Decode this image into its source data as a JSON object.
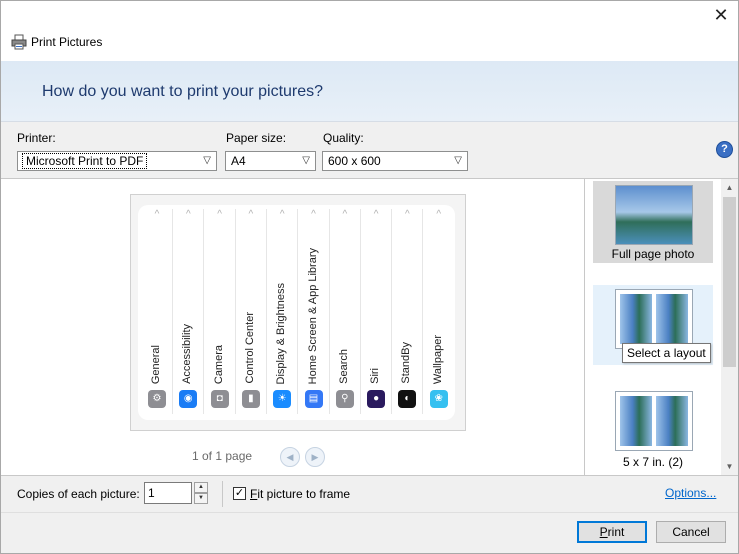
{
  "window": {
    "title": "Print Pictures",
    "close": "✕"
  },
  "header": {
    "question": "How do you want to print your pictures?"
  },
  "printer": {
    "label": "Printer:",
    "value": "Microsoft Print to PDF"
  },
  "paper_size": {
    "label": "Paper size:",
    "value": "A4"
  },
  "quality": {
    "label": "Quality:",
    "value": "600 x 600"
  },
  "help": {
    "glyph": "?"
  },
  "preview": {
    "settings": [
      {
        "label": "General",
        "color": "#8e8e93",
        "glyph": "⚙"
      },
      {
        "label": "Accessibility",
        "color": "#1a7cf5",
        "glyph": "◉"
      },
      {
        "label": "Camera",
        "color": "#8e8e93",
        "glyph": "◘"
      },
      {
        "label": "Control Center",
        "color": "#8e8e93",
        "glyph": "▮"
      },
      {
        "label": "Display & Brightness",
        "color": "#1a8cff",
        "glyph": "☀"
      },
      {
        "label": "Home Screen & App Library",
        "color": "#3478f6",
        "glyph": "▤"
      },
      {
        "label": "Search",
        "color": "#8e8e93",
        "glyph": "⚲"
      },
      {
        "label": "Siri",
        "color": "#2a1a5e",
        "glyph": "●"
      },
      {
        "label": "StandBy",
        "color": "#111111",
        "glyph": "◐"
      },
      {
        "label": "Wallpaper",
        "color": "#35c0f0",
        "glyph": "❀"
      }
    ],
    "chevron": "^",
    "page_count": "1 of 1 page",
    "prev": "◀",
    "next": "▶"
  },
  "layouts": [
    {
      "caption": "Full page photo"
    },
    {
      "caption": ""
    },
    {
      "caption": "5 x 7 in. (2)"
    }
  ],
  "tooltip": "Select a layout",
  "scrollbar": {
    "up": "▲",
    "down": "▼"
  },
  "copies": {
    "label": "Copies of each picture:",
    "value": "1",
    "up": "▲",
    "down": "▼"
  },
  "fit": {
    "label_rest": "it picture to frame",
    "label_first": "F",
    "checked": "✓"
  },
  "options_link": "Options...",
  "buttons": {
    "print_first": "P",
    "print_rest": "rint",
    "cancel": "Cancel"
  }
}
